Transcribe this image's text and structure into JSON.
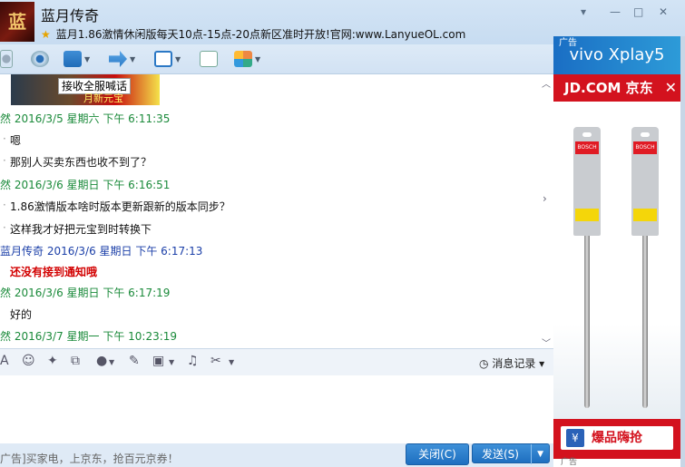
{
  "window": {
    "title": "蓝月传奇",
    "avatar_text": "蓝月",
    "subtitle": "蓝月1.86激情休闲版每天10点-15点-20点新区准时开放!官网:www.LanyueOL.com",
    "controls": [
      "▾",
      "—",
      "□",
      "✕"
    ]
  },
  "toolbar": {
    "icons": [
      "microphone-icon",
      "camera-icon",
      "screen-share-icon",
      "file-transfer-icon",
      "remote-desktop-icon",
      "add-app-icon",
      "apps-grid-icon"
    ]
  },
  "chat": {
    "banner_button": "接收全服喊话",
    "banner_text": "月新元宝",
    "messages": [
      {
        "type": "header",
        "color": "green",
        "text": "然 2016/3/5 星期六 下午 6:11:35"
      },
      {
        "type": "msg",
        "text": "嗯"
      },
      {
        "type": "msg",
        "text": "那别人买卖东西也收不到了？"
      },
      {
        "type": "header",
        "color": "green",
        "text": "然 2016/3/6 星期日 下午 6:16:51"
      },
      {
        "type": "msg",
        "text": "1.86激情版本啥时版本更新跟新的版本同步？"
      },
      {
        "type": "msg",
        "text": "这样我才好把元宝到时转换下"
      },
      {
        "type": "header",
        "color": "blue",
        "text": "蓝月传奇 2016/3/6 星期日 下午 6:17:13"
      },
      {
        "type": "red",
        "text": "还没有接到通知哦"
      },
      {
        "type": "header",
        "color": "green",
        "text": "然 2016/3/6 星期日 下午 6:17:19"
      },
      {
        "type": "msg",
        "text": "好的"
      },
      {
        "type": "header",
        "color": "green",
        "text": "然 2016/3/7 星期一 下午 10:23:19"
      }
    ]
  },
  "inputbar": {
    "history_label": "消息记录"
  },
  "bottom": {
    "ad_text": "广告]买家电，上京东，抢百元京券！",
    "close_label": "关闭(C)",
    "send_label": "发送(S)"
  },
  "ad": {
    "vivo_tag": "广告",
    "vivo_text": "vivo Xplay5",
    "jd_text": "JD.COM 京东",
    "jd_close": "✕",
    "buy_badge": "¥",
    "buy_label": "爆品嗨抢",
    "buy_tag": "广告"
  }
}
